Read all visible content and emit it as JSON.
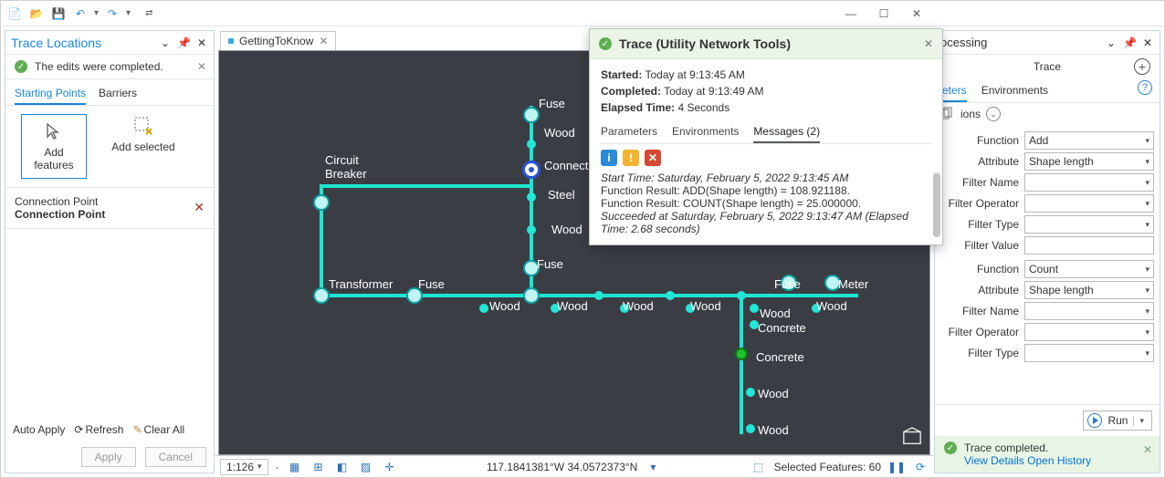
{
  "qat_icons": [
    "new-project-icon",
    "open-project-icon",
    "save-icon",
    "undo-icon",
    "redo-icon"
  ],
  "window_buttons": {
    "min": "—",
    "max": "☐",
    "close": "✕"
  },
  "left_pane": {
    "title": "Trace Locations",
    "notice": "The edits were completed.",
    "tabs": [
      "Starting Points",
      "Barriers"
    ],
    "btn_add_features": "Add\nfeatures",
    "btn_add_selected": "Add selected",
    "point_type": "Connection Point",
    "point_name": "Connection Point",
    "auto_apply": "Auto Apply",
    "refresh": "Refresh",
    "clear": "Clear All",
    "apply": "Apply",
    "cancel": "Cancel"
  },
  "doc_tab": "GettingToKnow",
  "map_labels": {
    "circuit": "Circuit\nBreaker",
    "transformer": "Transformer",
    "fuse": "Fuse",
    "steel": "Steel",
    "wood": "Wood",
    "concrete": "Concrete",
    "meter": "Meter",
    "connect": "Connect"
  },
  "status": {
    "scale": "1:126",
    "coords": "117.1841381°W 34.0572373°N",
    "selected": "Selected Features: 60"
  },
  "popup": {
    "title": "Trace (Utility Network Tools)",
    "started_lbl": "Started:",
    "started_val": "Today at 9:13:45 AM",
    "completed_lbl": "Completed:",
    "completed_val": "Today at 9:13:49 AM",
    "elapsed_lbl": "Elapsed Time:",
    "elapsed_val": "4 Seconds",
    "tabs": [
      "Parameters",
      "Environments",
      "Messages (2)"
    ],
    "messages": [
      "Start Time: Saturday, February 5, 2022 9:13:45 AM",
      "Function Result: ADD(Shape length) = 108.921188.",
      "Function Result: COUNT(Shape length) = 25.000000.",
      "Succeeded at Saturday, February 5, 2022 9:13:47 AM (Elapsed Time: 2.68 seconds)"
    ]
  },
  "right_pane": {
    "header": "ocessing",
    "tool": "Trace",
    "tabs": [
      "eters",
      "Environments"
    ],
    "section": "ions",
    "functions": [
      {
        "func": "Add",
        "attr": "Shape length"
      },
      {
        "func": "Count",
        "attr": "Shape length"
      }
    ],
    "labels": {
      "function": "Function",
      "attribute": "Attribute",
      "filter_name": "Filter Name",
      "filter_op": "Filter Operator",
      "filter_type": "Filter Type",
      "filter_val": "Filter Value"
    },
    "run": "Run",
    "status": "Trace completed.",
    "view": "View Details",
    "open": "Open History"
  }
}
